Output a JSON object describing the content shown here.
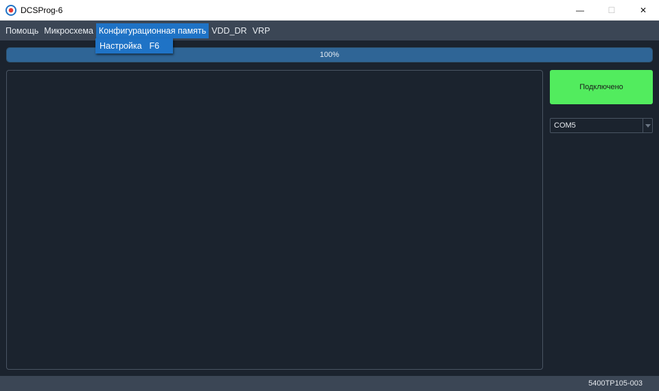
{
  "window": {
    "title": "DCSProg-6",
    "controls": {
      "minimize": "—",
      "maximize": "☐",
      "close": "✕"
    }
  },
  "menu": {
    "items": [
      {
        "label": "Помощь"
      },
      {
        "label": "Микросхема"
      },
      {
        "label": "Конфигурационная память"
      },
      {
        "label": "VDD_DR"
      },
      {
        "label": "VRP"
      }
    ],
    "dropdown": {
      "label": "Настройка",
      "shortcut": "F6"
    }
  },
  "progress": {
    "percent_text": "100%",
    "value": 100
  },
  "connect_button": {
    "label": "Подключено",
    "color": "#52ec5e"
  },
  "port_select": {
    "value": "COM5"
  },
  "status_bar": {
    "text": "5400ТР105-003"
  },
  "colors": {
    "accent": "#1f73c6",
    "background": "#1b232e",
    "bar": "#3b4655"
  }
}
